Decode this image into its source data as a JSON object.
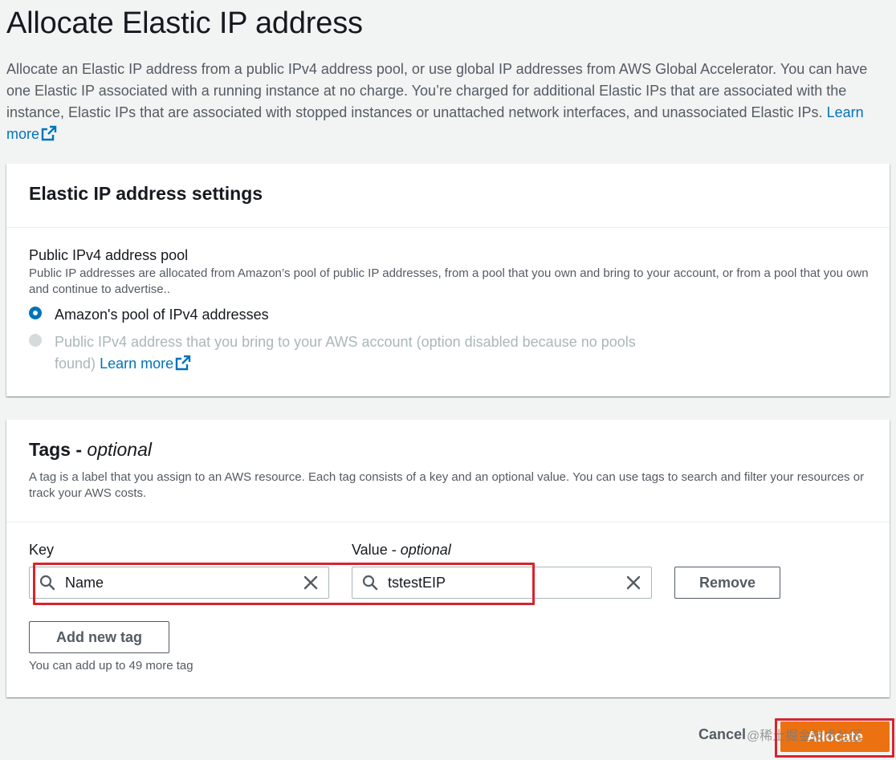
{
  "page": {
    "title": "Allocate Elastic IP address",
    "description": "Allocate an Elastic IP address from a public IPv4 address pool, or use global IP addresses from AWS Global Accelerator. You can have one Elastic IP associated with a running instance at no charge. You’re charged for additional Elastic IPs that are associated with the instance, Elastic IPs that are associated with stopped instances or unattached network interfaces, and unassociated Elastic IPs.",
    "learn_more": "Learn more"
  },
  "settings": {
    "title": "Elastic IP address settings",
    "pool_label": "Public IPv4 address pool",
    "pool_description": "Public IP addresses are allocated from Amazon’s pool of public IP addresses, from a pool that you own and bring to your account, or from a pool that you own and continue to advertise..",
    "options": [
      {
        "label": "Amazon's pool of IPv4 addresses",
        "selected": true,
        "disabled": false
      },
      {
        "label": "Public IPv4 address that you bring to your AWS account (option disabled because no pools found)",
        "selected": false,
        "disabled": true,
        "link": "Learn more"
      }
    ]
  },
  "tags": {
    "title": "Tags - ",
    "title_optional": "optional",
    "description": "A tag is a label that you assign to an AWS resource. Each tag consists of a key and an optional value. You can use tags to search and filter your resources or track your AWS costs.",
    "key_label": "Key",
    "value_label": "Value - ",
    "value_label_optional": "optional",
    "rows": [
      {
        "key": "Name",
        "value": "tstestEIP"
      }
    ],
    "remove_label": "Remove",
    "add_label": "Add new tag",
    "hint": "You can add up to 49 more tag"
  },
  "footer": {
    "cancel_label": "Cancel",
    "allocate_label": "Allocate",
    "watermark": "@稀土掘金技术社区"
  },
  "colors": {
    "primary": "#ec7211",
    "link": "#0073bb",
    "highlight": "#d9232e"
  }
}
